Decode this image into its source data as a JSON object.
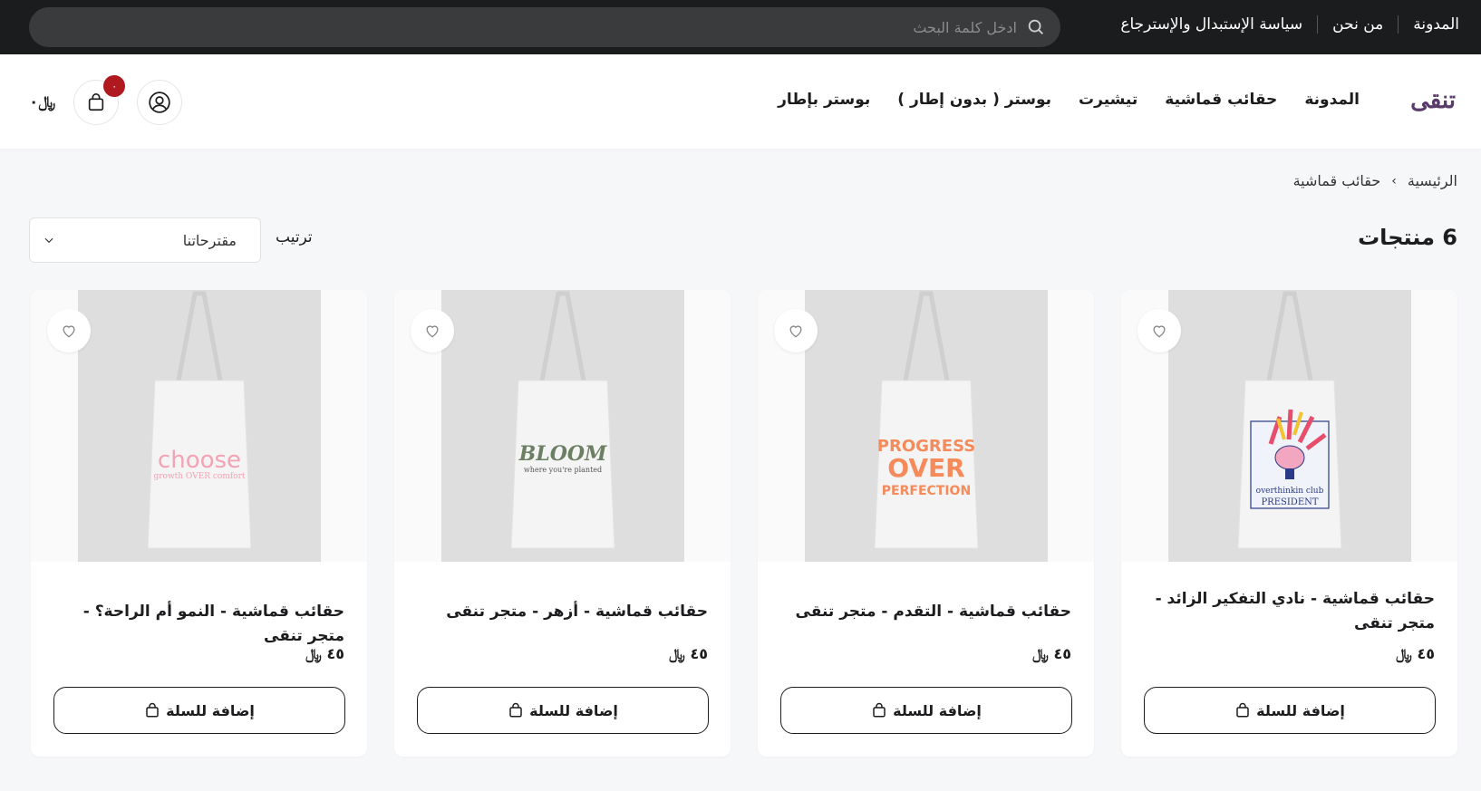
{
  "topbar": {
    "links": [
      "المدونة",
      "من نحن",
      "سياسة الإستبدال والإسترجاع"
    ],
    "search_placeholder": "ادخل كلمة البحث"
  },
  "header": {
    "logo": "تنقى",
    "nav": [
      "المدونة",
      "حقائب قماشية",
      "تيشيرت",
      "بوستر ( بدون إطار )",
      "بوستر بإطار"
    ],
    "cart_count": "٠",
    "cart_total": "٠",
    "currency": "﷼"
  },
  "breadcrumb": {
    "home": "الرئيسية",
    "current": "حقائب قماشية"
  },
  "toolbar": {
    "count": "6 منتجات",
    "sort_label": "ترتيب",
    "sort_value": "مقترحاتنا"
  },
  "products": [
    {
      "title": "حقائب قماشية - نادي التفكير الزائد - متجر تنقى",
      "price": "٤٥",
      "add": "إضافة للسلة",
      "print": "overthinkin club PRESIDENT"
    },
    {
      "title": "حقائب قماشية - التقدم - متجر تنقى",
      "price": "٤٥",
      "add": "إضافة للسلة",
      "print": "PROGRESS OVER PERFECTION"
    },
    {
      "title": "حقائب قماشية - أزهر - متجر تنقى",
      "price": "٤٥",
      "add": "إضافة للسلة",
      "print": "BLOOM where you're planted"
    },
    {
      "title": "حقائب قماشية - النمو أم الراحة؟ - متجر تنقى",
      "price": "٤٥",
      "add": "إضافة للسلة",
      "print": "choose growth OVER comfort"
    }
  ],
  "colors": {
    "topbar": "#1b1c1d",
    "badge": "#b0191f",
    "logo": "#5a3b6b"
  }
}
